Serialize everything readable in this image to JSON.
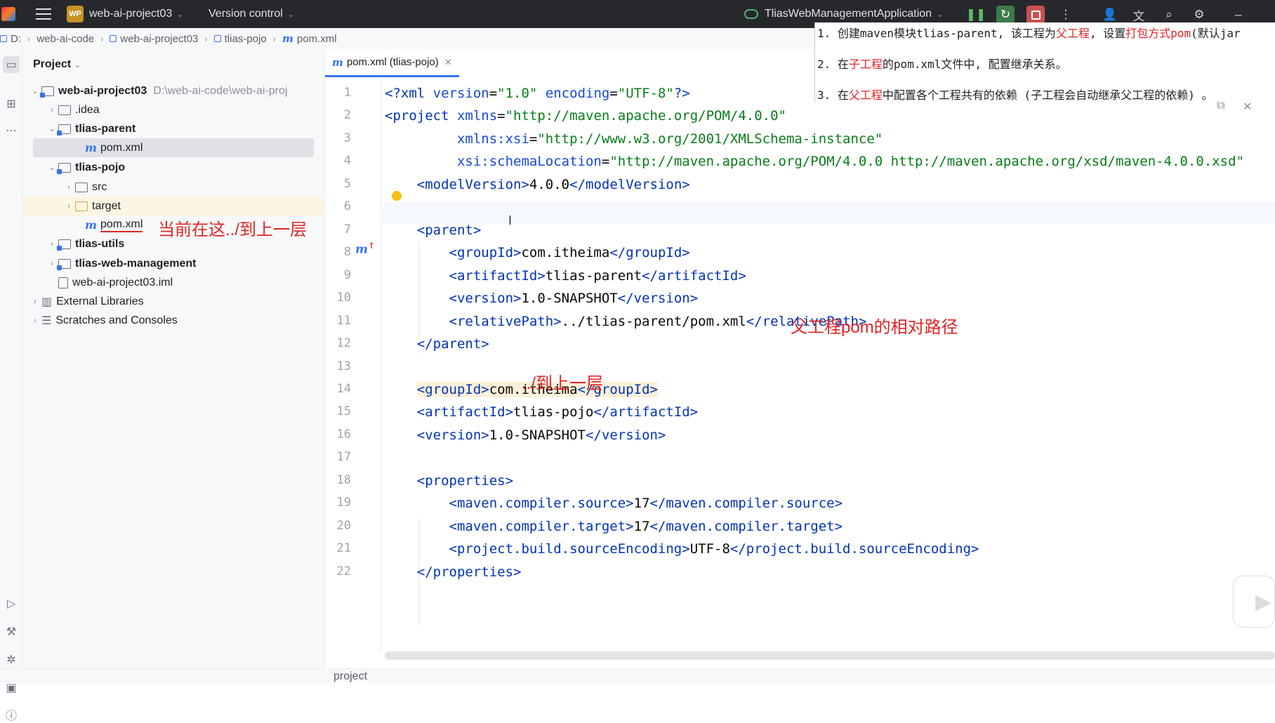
{
  "titlebar": {
    "project_badge": "WP",
    "project_name": "web-ai-project03",
    "version_control": "Version control",
    "run_config": "TliasWebManagementApplication"
  },
  "breadcrumb": [
    "D:",
    "web-ai-code",
    "web-ai-project03",
    "tlias-pojo",
    "pom.xml"
  ],
  "project_panel": {
    "title": "Project",
    "tree": [
      {
        "label": "web-ai-project03",
        "path": "D:\\web-ai-code\\web-ai-proj",
        "icon": "module-folder",
        "bold": true
      },
      {
        "label": ".idea",
        "icon": "folder"
      },
      {
        "label": "tlias-parent",
        "icon": "module-folder",
        "bold": true
      },
      {
        "label": "pom.xml",
        "icon": "maven-file"
      },
      {
        "label": "tlias-pojo",
        "icon": "module-folder",
        "bold": true
      },
      {
        "label": "src",
        "icon": "folder"
      },
      {
        "label": "target",
        "icon": "excluded-folder"
      },
      {
        "label": "pom.xml",
        "icon": "maven-file"
      },
      {
        "label": "tlias-utils",
        "icon": "module-folder",
        "bold": true
      },
      {
        "label": "tlias-web-management",
        "icon": "module-folder",
        "bold": true
      },
      {
        "label": "web-ai-project03.iml",
        "icon": "file"
      },
      {
        "label": "External Libraries",
        "icon": "library"
      },
      {
        "label": "Scratches and Consoles",
        "icon": "scratches"
      }
    ],
    "annotation": "当前在这../到上一层"
  },
  "editor": {
    "tab_label": "pom.xml (tlias-pojo)",
    "line_numbers": [
      "1",
      "2",
      "3",
      "4",
      "5",
      "6",
      "7",
      "8",
      "9",
      "10",
      "11",
      "12",
      "13",
      "14",
      "15",
      "16",
      "17",
      "18",
      "19",
      "20",
      "21",
      "22"
    ],
    "annotation_relative": "父工程pom的相对路径",
    "annotation_up": "../到上一层"
  },
  "notes": [
    {
      "prefix": "1. 创建maven模块tlias-parent, 该工程为",
      "red1": "父工程",
      "mid": ", 设置",
      "red2": "打包方式pom",
      "suffix": "(默认jar"
    },
    {
      "prefix": "2. 在",
      "red1": "子工程",
      "mid": "的pom.xml文件中, 配置继承关系。",
      "red2": "",
      "suffix": ""
    },
    {
      "prefix": "3. 在",
      "red1": "父工程",
      "mid": "中配置各个工程共有的依赖 (子工程会自动继承父工程的依赖) 。",
      "red2": "",
      "suffix": ""
    }
  ],
  "statusbar": {
    "path": "project"
  }
}
